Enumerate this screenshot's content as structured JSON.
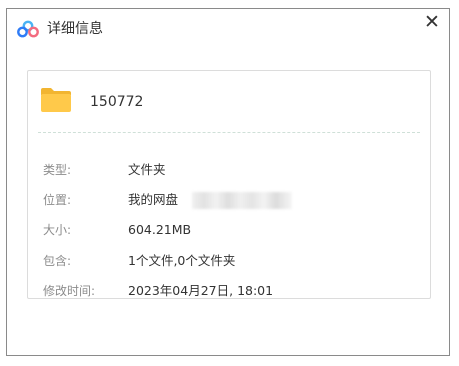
{
  "dialog": {
    "title": "详细信息",
    "close_symbol": "✕",
    "icon": "baidu-netdisk-logo-icon",
    "accent_colors": {
      "blue": "#2f7cf6",
      "sky": "#4ab3f4",
      "pink": "#f36b7f"
    }
  },
  "file": {
    "icon": "folder-icon",
    "icon_color": "#ffc94a",
    "name": "150772"
  },
  "details": {
    "type": {
      "label": "类型:",
      "value": "文件夹"
    },
    "location": {
      "label": "位置:",
      "value": "我的网盘"
    },
    "size": {
      "label": "大小:",
      "value": "604.21MB"
    },
    "contains": {
      "label": "包含:",
      "value": "1个文件,0个文件夹"
    },
    "modified": {
      "label": "修改时间:",
      "value": "2023年04月27日, 18:01"
    }
  }
}
